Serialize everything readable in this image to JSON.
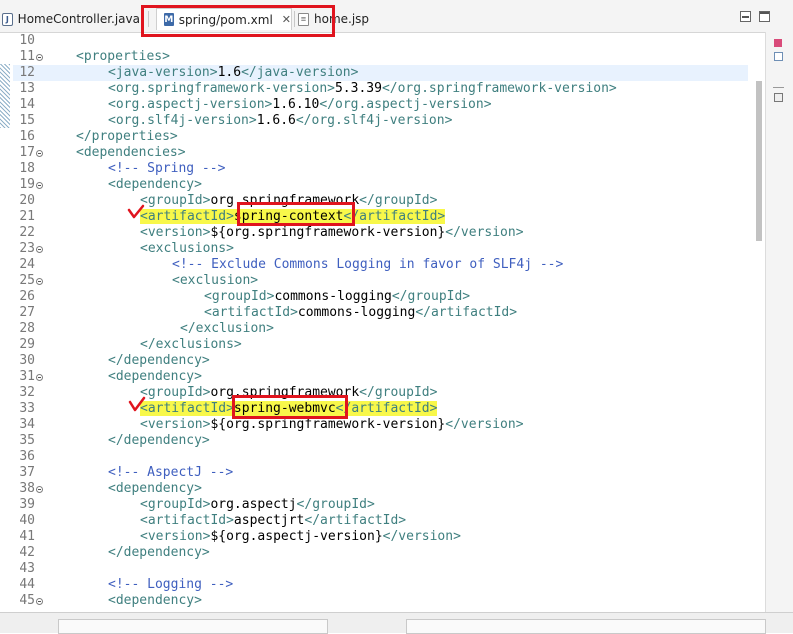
{
  "tabs": [
    {
      "label": "HomeController.java",
      "icon": "java-file-icon",
      "icon_glyph": "J"
    },
    {
      "label": "spring/pom.xml",
      "icon": "maven-pom-icon",
      "icon_glyph": "M",
      "close": "✕"
    },
    {
      "label": "home.jsp",
      "icon": "jsp-file-icon",
      "icon_glyph": "≡"
    }
  ],
  "editor": {
    "current_line": 12,
    "lines": [
      {
        "n": "10",
        "indent": 0,
        "parts": []
      },
      {
        "n": "11",
        "fold": true,
        "indent": 0,
        "parts": [
          [
            "t",
            "<properties>"
          ]
        ]
      },
      {
        "n": "12",
        "indent": 1,
        "parts": [
          [
            "t",
            "<java-version>"
          ],
          [
            "x",
            "1.6"
          ],
          [
            "t",
            "</java-version>"
          ]
        ]
      },
      {
        "n": "13",
        "indent": 1,
        "parts": [
          [
            "t",
            "<org.springframework-version>"
          ],
          [
            "x",
            "5.3.39"
          ],
          [
            "t",
            "</org.springframework-version>"
          ]
        ]
      },
      {
        "n": "14",
        "indent": 1,
        "parts": [
          [
            "t",
            "<org.aspectj-version>"
          ],
          [
            "x",
            "1.6.10"
          ],
          [
            "t",
            "</org.aspectj-version>"
          ]
        ]
      },
      {
        "n": "15",
        "indent": 1,
        "parts": [
          [
            "t",
            "<org.slf4j-version>"
          ],
          [
            "x",
            "1.6.6"
          ],
          [
            "t",
            "</org.slf4j-version>"
          ]
        ]
      },
      {
        "n": "16",
        "indent": 0,
        "parts": [
          [
            "t",
            "</properties>"
          ]
        ]
      },
      {
        "n": "17",
        "fold": true,
        "indent": 0,
        "parts": [
          [
            "t",
            "<dependencies>"
          ]
        ]
      },
      {
        "n": "18",
        "indent": 1,
        "parts": [
          [
            "c",
            "<!-- Spring -->"
          ]
        ]
      },
      {
        "n": "19",
        "fold": true,
        "indent": 1,
        "parts": [
          [
            "t",
            "<dependency>"
          ]
        ]
      },
      {
        "n": "20",
        "indent": 2,
        "parts": [
          [
            "t",
            "<groupId>"
          ],
          [
            "x",
            "org.springframework"
          ],
          [
            "t",
            "</groupId>"
          ]
        ]
      },
      {
        "n": "21",
        "indent": 2,
        "highlight": true,
        "parts": [
          [
            "t",
            "<artifactId>"
          ],
          [
            "x",
            "spring-context"
          ],
          [
            "t",
            "</artifactId>"
          ]
        ]
      },
      {
        "n": "22",
        "indent": 2,
        "parts": [
          [
            "t",
            "<version>"
          ],
          [
            "x",
            "${org.springframework-version}"
          ],
          [
            "t",
            "</version>"
          ]
        ]
      },
      {
        "n": "23",
        "fold": true,
        "indent": 2,
        "parts": [
          [
            "t",
            "<exclusions>"
          ]
        ]
      },
      {
        "n": "24",
        "indent": 3,
        "parts": [
          [
            "c",
            "<!-- Exclude Commons Logging in favor of SLF4j -->"
          ]
        ]
      },
      {
        "n": "25",
        "fold": true,
        "indent": 3,
        "parts": [
          [
            "t",
            "<exclusion>"
          ]
        ]
      },
      {
        "n": "26",
        "indent": 4,
        "parts": [
          [
            "t",
            "<groupId>"
          ],
          [
            "x",
            "commons-logging"
          ],
          [
            "t",
            "</groupId>"
          ]
        ]
      },
      {
        "n": "27",
        "indent": 4,
        "parts": [
          [
            "t",
            "<artifactId>"
          ],
          [
            "x",
            "commons-logging"
          ],
          [
            "t",
            "</artifactId>"
          ]
        ]
      },
      {
        "n": "28",
        "indent": 3,
        "extra": 1,
        "parts": [
          [
            "t",
            "</exclusion>"
          ]
        ]
      },
      {
        "n": "29",
        "indent": 2,
        "parts": [
          [
            "t",
            "</exclusions>"
          ]
        ]
      },
      {
        "n": "30",
        "indent": 1,
        "parts": [
          [
            "t",
            "</dependency>"
          ]
        ]
      },
      {
        "n": "31",
        "fold": true,
        "indent": 1,
        "parts": [
          [
            "t",
            "<dependency>"
          ]
        ]
      },
      {
        "n": "32",
        "indent": 2,
        "parts": [
          [
            "t",
            "<groupId>"
          ],
          [
            "x",
            "org.springframework"
          ],
          [
            "t",
            "</groupId>"
          ]
        ]
      },
      {
        "n": "33",
        "indent": 2,
        "highlight": true,
        "parts": [
          [
            "t",
            "<artifactId>"
          ],
          [
            "x",
            "spring-webmvc"
          ],
          [
            "t",
            "</artifactId>"
          ]
        ]
      },
      {
        "n": "34",
        "indent": 2,
        "parts": [
          [
            "t",
            "<version>"
          ],
          [
            "x",
            "${org.springframework-version}"
          ],
          [
            "t",
            "</version>"
          ]
        ]
      },
      {
        "n": "35",
        "indent": 1,
        "parts": [
          [
            "t",
            "</dependency>"
          ]
        ]
      },
      {
        "n": "36",
        "indent": 0,
        "parts": []
      },
      {
        "n": "37",
        "indent": 1,
        "parts": [
          [
            "c",
            "<!-- AspectJ -->"
          ]
        ]
      },
      {
        "n": "38",
        "fold": true,
        "indent": 1,
        "parts": [
          [
            "t",
            "<dependency>"
          ]
        ]
      },
      {
        "n": "39",
        "indent": 2,
        "parts": [
          [
            "t",
            "<groupId>"
          ],
          [
            "x",
            "org.aspectj"
          ],
          [
            "t",
            "</groupId>"
          ]
        ]
      },
      {
        "n": "40",
        "indent": 2,
        "parts": [
          [
            "t",
            "<artifactId>"
          ],
          [
            "x",
            "aspectjrt"
          ],
          [
            "t",
            "</artifactId>"
          ]
        ]
      },
      {
        "n": "41",
        "indent": 2,
        "parts": [
          [
            "t",
            "<version>"
          ],
          [
            "x",
            "${org.aspectj-version}"
          ],
          [
            "t",
            "</version>"
          ]
        ]
      },
      {
        "n": "42",
        "indent": 1,
        "parts": [
          [
            "t",
            "</dependency>"
          ]
        ]
      },
      {
        "n": "43",
        "indent": 0,
        "parts": []
      },
      {
        "n": "44",
        "indent": 1,
        "parts": [
          [
            "c",
            "<!-- Logging -->"
          ]
        ]
      },
      {
        "n": "45",
        "fold": true,
        "indent": 1,
        "parts": [
          [
            "t",
            "<dependency>"
          ]
        ]
      }
    ]
  },
  "colors": {
    "tag": "#3f7f7f",
    "comment": "#3f5fbf",
    "text": "#000000",
    "highlight": "#f8f84a",
    "annotation_red": "#e0141e",
    "current_line_bg": "#e8f2fe"
  },
  "annotations": [
    "red-box-tab-pom",
    "red-box-spring-context",
    "red-box-spring-webmvc",
    "checkmark-line-21",
    "checkmark-line-33"
  ],
  "toolbar_icons": [
    "outline-icon",
    "task-list-icon",
    "quick-access-icon"
  ]
}
